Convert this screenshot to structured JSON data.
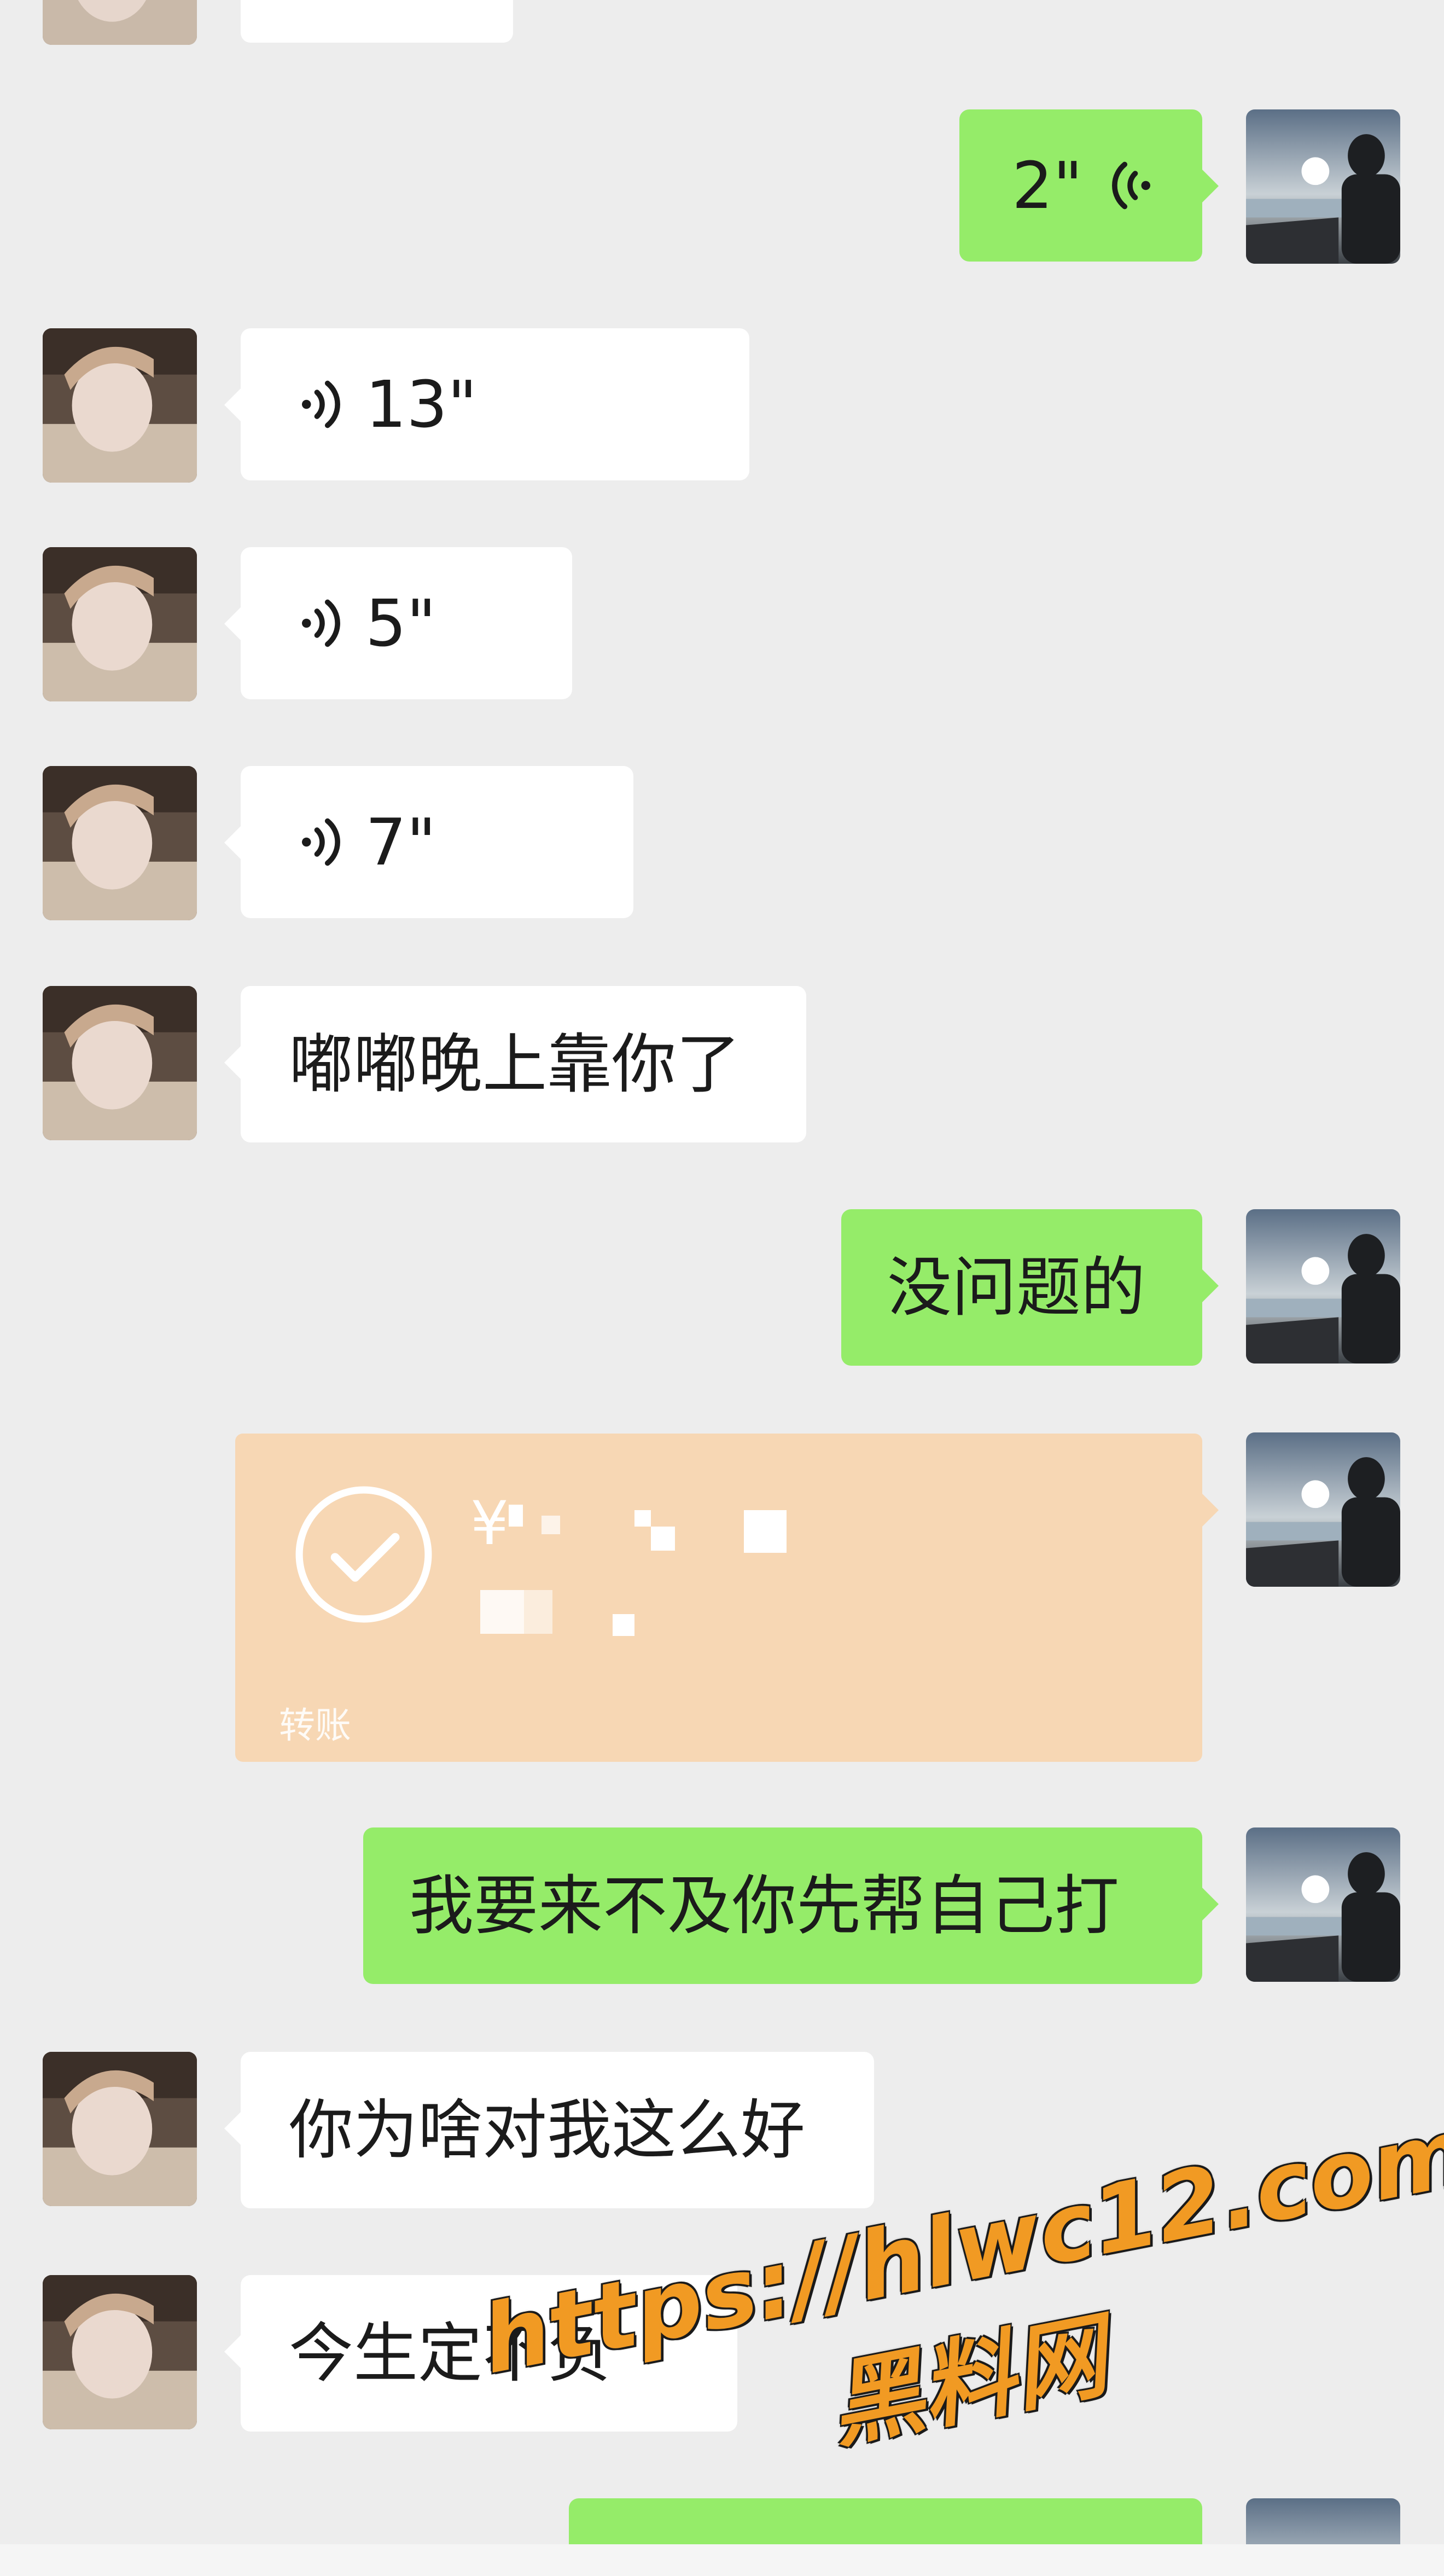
{
  "colors": {
    "background": "#ededed",
    "incoming_bubble": "#ffffff",
    "outgoing_bubble": "#95ec69",
    "transfer_card": "#f7d7b4",
    "watermark": "#f19a23"
  },
  "messages": {
    "m1_out_voice": {
      "duration": "2\""
    },
    "m2_in_voice": {
      "duration": "13\""
    },
    "m3_in_voice": {
      "duration": "5\""
    },
    "m4_in_voice": {
      "duration": "7\""
    },
    "m5_in_text": {
      "text": "嘟嘟晚上靠你了"
    },
    "m6_out_text": {
      "text": "没问题的"
    },
    "m7_out_transfer": {
      "currency": "¥",
      "label": "转账"
    },
    "m8_out_text": {
      "text": "我要来不及你先帮自己打"
    },
    "m9_in_text": {
      "text": "你为啥对我这么好"
    },
    "m10_in_text": {
      "text": "今生定不负"
    }
  },
  "watermark": {
    "url": "https://hlwc12.com",
    "name": "黑料网"
  },
  "icons": {
    "voice": "voice-wave-icon",
    "transfer_done": "check-circle-icon",
    "avatar_friend": "avatar-girl",
    "avatar_self": "avatar-sunset"
  }
}
